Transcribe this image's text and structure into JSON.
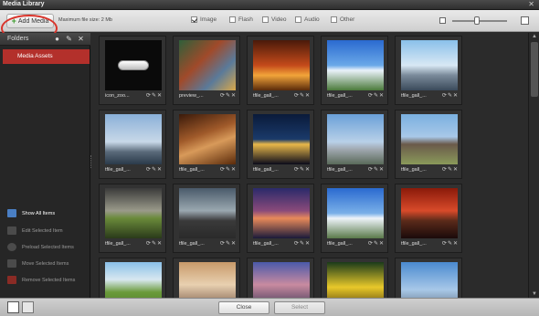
{
  "window": {
    "title": "Media Library",
    "close_glyph": "✕"
  },
  "toolbar": {
    "add_media_label": "Add Media",
    "max_file_size": "Maximum file size: 2 Mb",
    "filters": [
      {
        "label": "Image",
        "checked": true
      },
      {
        "label": "Flash",
        "checked": false
      },
      {
        "label": "Video",
        "checked": false
      },
      {
        "label": "Audio",
        "checked": false
      },
      {
        "label": "Other",
        "checked": false
      }
    ],
    "zoom_level": 0.45
  },
  "sidebar": {
    "folders_label": "Folders",
    "folders": [
      {
        "label": "Media Assets",
        "selected": true
      }
    ],
    "actions": [
      {
        "label": "Show All Items",
        "active": true,
        "icon": "show-all-icon",
        "color": "#4a7fc4"
      },
      {
        "label": "Edit Selected Item",
        "active": false,
        "icon": "edit-icon",
        "color": "#4b4b4b"
      },
      {
        "label": "Preload Selected Items",
        "active": false,
        "icon": "preload-icon",
        "color": "#4b4b4b"
      },
      {
        "label": "Move Selected Items",
        "active": false,
        "icon": "move-icon",
        "color": "#4b4b4b"
      },
      {
        "label": "Remove Selected Items",
        "active": false,
        "icon": "remove-icon",
        "color": "#8a2b25"
      }
    ]
  },
  "grid": {
    "tiles": [
      {
        "name": "icon_zoo...",
        "bg": "linear-gradient(#0a0a0a,#0a0a0a)",
        "kind": "pill"
      },
      {
        "name": "preview_...",
        "bg": "linear-gradient(135deg,#2f5f3a,#a04a2a 40%,#5a7a9a 70%,#d9a84a)",
        "kind": "photo"
      },
      {
        "name": "tfile_gall_...",
        "bg": "linear-gradient(#4a1a0a,#c44a1a 50%,#f2a43a 70%,#5a2a0a)",
        "kind": "photo"
      },
      {
        "name": "tfile_gall_...",
        "bg": "linear-gradient(#2a6ad0,#6aa8e8 50%,#eaf2fa 60%,#4a7a3a)",
        "kind": "photo"
      },
      {
        "name": "tfile_gall_...",
        "bg": "linear-gradient(#8ac0ea,#d8e8f4 50%,#7a8a9a 70%,#3a4a5a)",
        "kind": "photo"
      },
      {
        "name": "tfile_gall_...",
        "bg": "linear-gradient(#8ab0d8,#c8d8e8 55%,#5a6a7a 75%,#2a3a4a)",
        "kind": "photo"
      },
      {
        "name": "tfile_gall_...",
        "bg": "linear-gradient(160deg,#3a1a0a,#a05a2a 40%,#d89a5a 60%,#5a2a0a)",
        "kind": "photo"
      },
      {
        "name": "tfile_gall_...",
        "bg": "linear-gradient(#0a1a3a,#1a3a6a 50%,#e8b84a 60%,#0a0a1a)",
        "kind": "photo"
      },
      {
        "name": "tfile_gall_...",
        "bg": "linear-gradient(#6aa0d8,#b8d0e8 55%,#a0a8b0 70%,#5a6a5a)",
        "kind": "photo"
      },
      {
        "name": "tfile_gall_...",
        "bg": "linear-gradient(#7ab0e0,#a8c8e8 45%,#6a5a4a 60%,#8a9a5a)",
        "kind": "photo"
      },
      {
        "name": "tfile_gall_...",
        "bg": "linear-gradient(#3a3a3a,#9a9a8a 45%,#6a8a3a 60%,#2a3a1a)",
        "kind": "photo"
      },
      {
        "name": "tfile_gall_...",
        "bg": "linear-gradient(#4a5a6a,#9aa8b0 45%,#3a3a3a 65%,#2a2a2a)",
        "kind": "photo"
      },
      {
        "name": "tfile_gall_...",
        "bg": "linear-gradient(#2a2a6a,#8a4a7a 45%,#e88a5a 60%,#1a1a3a)",
        "kind": "photo"
      },
      {
        "name": "tfile_gall_...",
        "bg": "linear-gradient(#2a6ad0,#7ab0e8 50%,#eef4fa 60%,#5a7a4a)",
        "kind": "photo"
      },
      {
        "name": "tfile_gall_...",
        "bg": "linear-gradient(#8a1a0a,#d84a2a 45%,#5a2a1a 65%,#1a0a0a)",
        "kind": "photo"
      },
      {
        "name": "",
        "bg": "linear-gradient(#8ac0e8,#d8e8f0 35%,#6a9a3a 60%,#4a7a2a)",
        "kind": "photo"
      },
      {
        "name": "",
        "bg": "linear-gradient(#c89a6a,#e8d0b0 45%,#6a4a3a)",
        "kind": "photo"
      },
      {
        "name": "",
        "bg": "linear-gradient(#4a5aaa,#c88aa0 45%,#2a2a4a)",
        "kind": "photo"
      },
      {
        "name": "",
        "bg": "linear-gradient(#1a3a1a,#e8c82a 50%,#3a2a0a)",
        "kind": "photo"
      },
      {
        "name": "",
        "bg": "linear-gradient(#4a8ad0,#a8c8e8 55%,#5a6a7a)",
        "kind": "photo"
      }
    ],
    "tile_action_glyphs": [
      "⟳",
      "✎",
      "✕"
    ]
  },
  "footer": {
    "close_label": "Close",
    "select_label": "Select"
  }
}
